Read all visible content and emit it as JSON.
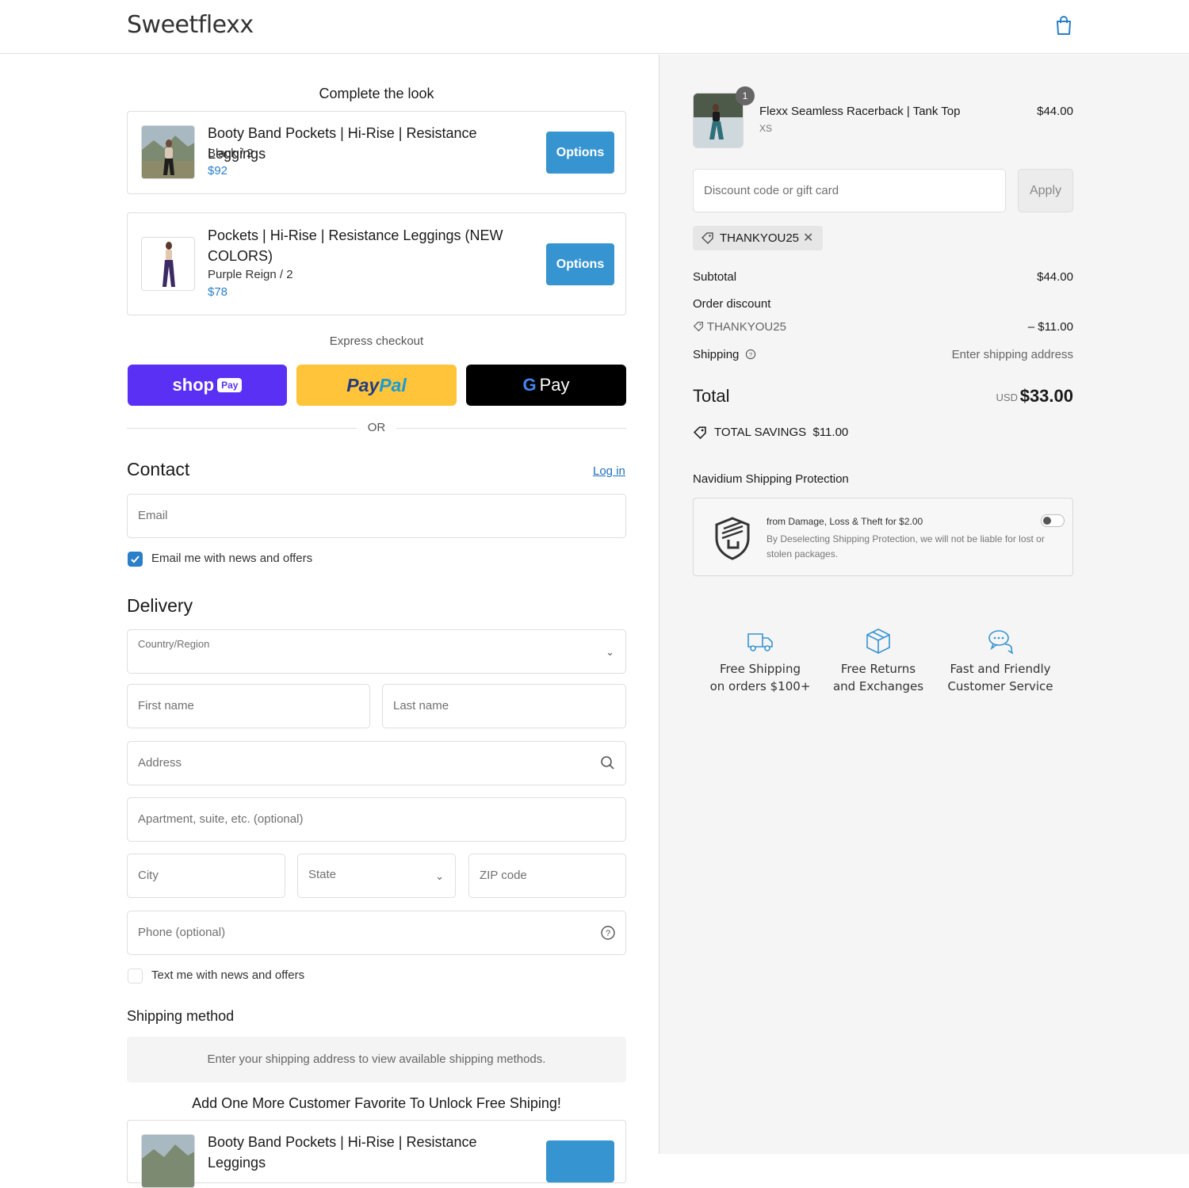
{
  "header": {
    "logo": "Sweetflexx",
    "cart_icon": "shopping-bag-icon"
  },
  "upsell_top": {
    "title": "Complete the look",
    "items": [
      {
        "name": "Booty Band Pockets | Hi-Rise | Resistance Leggings",
        "variant": "Black / 2",
        "price": "$92",
        "button": "Options"
      },
      {
        "name": "Pockets | Hi-Rise | Resistance Leggings (NEW COLORS)",
        "variant": "Purple Reign / 2",
        "price": "$78",
        "button": "Options"
      }
    ]
  },
  "express": {
    "label": "Express checkout",
    "shop_pay": "shop",
    "shop_pay_badge": "Pay",
    "paypal_a": "Pay",
    "paypal_b": "Pal",
    "gpay_g": "G",
    "gpay_text": "Pay",
    "or": "OR"
  },
  "contact": {
    "title": "Contact",
    "login": "Log in",
    "email_placeholder": "Email",
    "news_checkbox_label": "Email me with news and offers",
    "news_checked": true
  },
  "delivery": {
    "title": "Delivery",
    "country_label": "Country/Region",
    "first_name": "First name",
    "last_name": "Last name",
    "address": "Address",
    "apartment": "Apartment, suite, etc. (optional)",
    "city": "City",
    "state": "State",
    "zip": "ZIP code",
    "phone": "Phone (optional)",
    "text_checkbox_label": "Text me with news and offers",
    "text_checked": false
  },
  "shipping_method": {
    "title": "Shipping method",
    "message": "Enter your shipping address to view available shipping methods."
  },
  "upsell_bottom": {
    "title": "Add One More Customer Favorite To Unlock Free Shiping!",
    "item_name": "Booty Band Pockets | Hi-Rise | Resistance Leggings"
  },
  "summary": {
    "product": {
      "name": "Flexx Seamless Racerback | Tank Top",
      "variant": "XS",
      "price": "$44.00",
      "quantity": "1"
    },
    "discount_placeholder": "Discount code or gift card",
    "apply": "Apply",
    "applied_code": "THANKYOU25",
    "subtotal_label": "Subtotal",
    "subtotal": "$44.00",
    "order_discount_label": "Order discount",
    "discount_code": "THANKYOU25",
    "discount_value": "– $11.00",
    "shipping_label": "Shipping",
    "shipping_value": "Enter shipping address",
    "total_label": "Total",
    "currency": "USD",
    "total": "$33.00",
    "savings_label": "TOTAL SAVINGS",
    "savings_value": "$11.00"
  },
  "protection": {
    "title": "Navidium Shipping Protection",
    "line1": "from Damage, Loss & Theft for $2.00",
    "line2": "By Deselecting Shipping Protection, we will not be liable for lost or stolen packages.",
    "enabled": false
  },
  "perks": [
    {
      "icon": "truck-icon",
      "line1": "Free Shipping",
      "line2": "on orders $100+"
    },
    {
      "icon": "box-icon",
      "line1": "Free Returns",
      "line2": "and Exchanges"
    },
    {
      "icon": "chat-bubbles-icon",
      "line1": "Fast and Friendly",
      "line2": "Customer Service"
    }
  ],
  "colors": {
    "accent": "#3694d1",
    "link": "#1f6fbd",
    "shop_pay": "#5a31f4",
    "paypal": "#ffc439",
    "gpay": "#000000"
  }
}
